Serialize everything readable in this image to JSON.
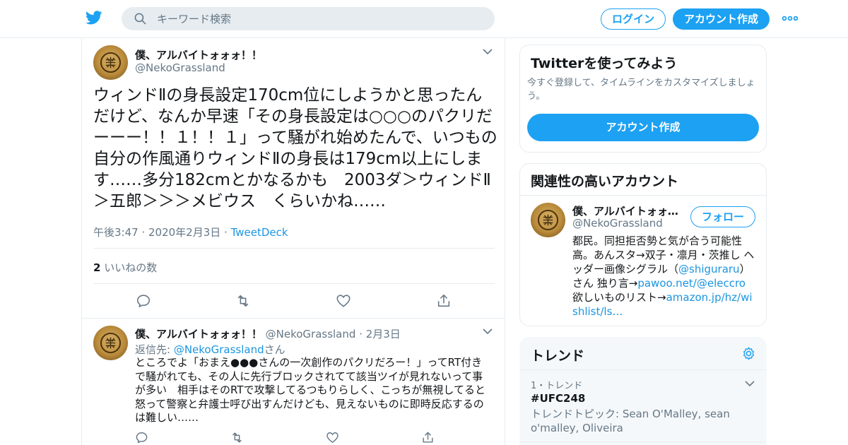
{
  "header": {
    "search_placeholder": "キーワード検索",
    "login_label": "ログイン",
    "signup_label": "アカウント作成"
  },
  "tweet": {
    "name": "僕、アルバイトォォォ！！",
    "handle": "@NekoGrassland",
    "text": "ウィンドⅡの身長設定170cm位にしようかと思ったんだけど、なんか早速「その身長設定は○○○のパクリだーーー！！１！！１」って騒がれ始めたんで、いつもの自分の作風通りウィンドⅡの身長は179cm以上にします……多分182cmとかなるかも　2003ダ＞ウィンドⅡ＞五郎＞＞＞メビウス　くらいかね……",
    "time": "午後3:47 · 2020年2月3日 · ",
    "source": "TweetDeck",
    "like_count": "2",
    "like_label": " いいねの数"
  },
  "reply": {
    "name": "僕、アルバイトォォォ！！",
    "handle": " @NekoGrassland · 2月3日",
    "reply_to_label": "返信先: ",
    "reply_to_handle": "@NekoGrassland",
    "reply_to_suffix": "さん",
    "text": "ところでよ「おまえ●●●さんの一次創作のパクリだろー！」ってRT付きで騒がれても、その人に先行ブロックされてて該当ツイが見れないって事が多い　相手はそのRTで攻撃してるつもりらしく、こっちが無視してると怒って警察と弁護士呼び出すんだけども、見えないものに即時反応するのは難しい……"
  },
  "signup_card": {
    "title": "Twitterを使ってみよう",
    "subtitle": "今すぐ登録して、タイムラインをカスタマイズしましょう。",
    "button_label": "アカウント作成"
  },
  "related_accounts": {
    "title": "関連性の高いアカウント",
    "account": {
      "name": "僕、アルバイトォォォ！！",
      "handle": "@NekoGrassland",
      "follow_label": "フォロー",
      "bio_1": "都民。同担拒否勢と気が合う可能性高。あんスタ→双子・凛月・茨推し ヘッダー画像シグラル（",
      "bio_link_1": "@shiguraru",
      "bio_2": "）さん 独り言→",
      "bio_link_2": "pawoo.net/@eleccro",
      "bio_3": " 欲しいものリスト→",
      "bio_link_3": "amazon.jp/hz/wishlist/ls…"
    }
  },
  "trends": {
    "title": "トレンド",
    "items": [
      {
        "rank_label": "1・トレンド",
        "name": "#UFC248",
        "topic": "トレンドトピック: Sean O'Malley, sean o'malley, Oliveira"
      }
    ]
  },
  "colors": {
    "accent": "#1da1f2",
    "link": "#1b95e0",
    "secondary_text": "#657786",
    "border": "#e6ecf0"
  },
  "icons": [
    "twitter-bird-icon",
    "search-icon",
    "more-icon",
    "chevron-down-icon",
    "reply-icon",
    "retweet-icon",
    "like-icon",
    "share-icon",
    "gear-icon"
  ]
}
